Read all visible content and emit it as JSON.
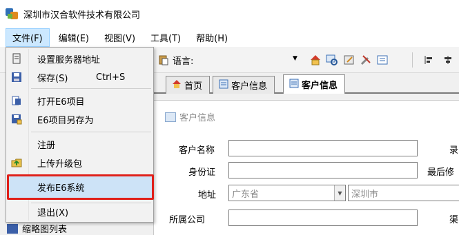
{
  "window": {
    "title": "深圳市汉合软件技术有限公司"
  },
  "menubar": {
    "items": [
      {
        "label": "文件(F)"
      },
      {
        "label": "编辑(E)"
      },
      {
        "label": "视图(V)"
      },
      {
        "label": "工具(T)"
      },
      {
        "label": "帮助(H)"
      }
    ]
  },
  "toolbar": {
    "language_label": "语言:",
    "language_value": "",
    "icons": [
      "paste-icon",
      "home-icon",
      "search-icon",
      "edit-icon",
      "tools-icon",
      "list-icon",
      "align-icon",
      "more-icon"
    ]
  },
  "tabs": [
    {
      "label": "首页",
      "icon": "home-icon"
    },
    {
      "label": "客户信息",
      "icon": "form-icon"
    },
    {
      "label": "客户信息",
      "icon": "form-icon",
      "active": true
    }
  ],
  "panel": {
    "title": "客户信息",
    "fields": {
      "customer_name": {
        "label": "客户名称",
        "value": ""
      },
      "id_card": {
        "label": "身份证",
        "value": ""
      },
      "address": {
        "label": "地址",
        "province": "广东省",
        "city": "深圳市"
      },
      "company": {
        "label": "所属公司",
        "value": ""
      },
      "right_1": "录",
      "right_2": "最后修",
      "right_3": "渠"
    }
  },
  "file_menu": {
    "items": [
      {
        "label": "设置服务器地址",
        "icon": "server-icon"
      },
      {
        "label": "保存(S)",
        "shortcut": "Ctrl+S",
        "icon": "save-icon"
      },
      {
        "label": "打开E6项目",
        "icon": "open-icon"
      },
      {
        "label": "E6项目另存为",
        "icon": "save-as-icon"
      },
      {
        "label": "注册",
        "icon": ""
      },
      {
        "label": "上传升级包",
        "icon": "upload-folder-icon"
      },
      {
        "label": "发布E6系统",
        "icon": "",
        "highlighted": true
      },
      {
        "label": "退出(X)",
        "icon": ""
      }
    ]
  },
  "underlying": {
    "label": "缩略图列表"
  },
  "colors": {
    "highlight": "#cde3f7",
    "annotation_red": "#e0201a",
    "accent": "#2f6fb7"
  }
}
